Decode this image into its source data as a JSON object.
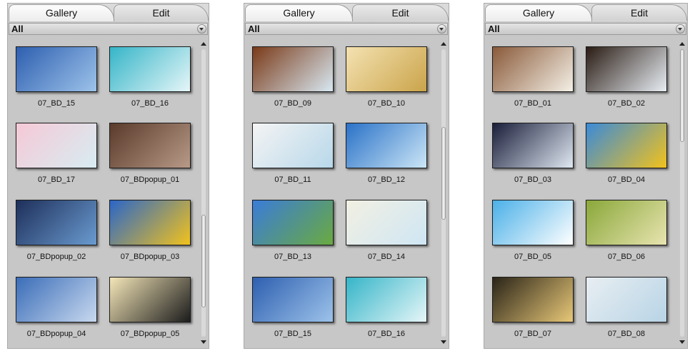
{
  "panels": [
    {
      "tabs": [
        "Gallery",
        "Edit"
      ],
      "filter": "All",
      "scroll_fraction": 0.85,
      "items": [
        {
          "label": "07_BD_15",
          "colors": [
            "#2e5fb0",
            "#9dc3ea"
          ]
        },
        {
          "label": "07_BD_16",
          "colors": [
            "#35b5c8",
            "#e6f6f8"
          ]
        },
        {
          "label": "07_BD_17",
          "colors": [
            "#f5c9d6",
            "#d8ecf2"
          ]
        },
        {
          "label": "07_BDpopup_01",
          "colors": [
            "#5a3a2a",
            "#b89a88"
          ]
        },
        {
          "label": "07_BDpopup_02",
          "colors": [
            "#1e2f5a",
            "#6a9bd0"
          ]
        },
        {
          "label": "07_BDpopup_03",
          "colors": [
            "#2a66c8",
            "#f2c21c"
          ]
        },
        {
          "label": "07_BDpopup_04",
          "colors": [
            "#3a6db8",
            "#c9d9ef"
          ]
        },
        {
          "label": "07_BDpopup_05",
          "colors": [
            "#f4e6b8",
            "#1c1c1c"
          ]
        }
      ]
    },
    {
      "tabs": [
        "Gallery",
        "Edit"
      ],
      "filter": "All",
      "scroll_fraction": 0.4,
      "items": [
        {
          "label": "07_BD_09",
          "colors": [
            "#7a3a18",
            "#d8e8f2"
          ]
        },
        {
          "label": "07_BD_10",
          "colors": [
            "#f4e2b2",
            "#caa44a"
          ]
        },
        {
          "label": "07_BD_11",
          "colors": [
            "#f4f4f4",
            "#b8d8ea"
          ]
        },
        {
          "label": "07_BD_12",
          "colors": [
            "#2a72c8",
            "#cce6f6"
          ]
        },
        {
          "label": "07_BD_13",
          "colors": [
            "#3a7cd8",
            "#6aaa40"
          ]
        },
        {
          "label": "07_BD_14",
          "colors": [
            "#f2f0e2",
            "#cfe6f4"
          ]
        },
        {
          "label": "07_BD_15",
          "colors": [
            "#2e5fb0",
            "#9dc3ea"
          ]
        },
        {
          "label": "07_BD_16",
          "colors": [
            "#35b5c8",
            "#e6f6f8"
          ]
        }
      ]
    },
    {
      "tabs": [
        "Gallery",
        "Edit"
      ],
      "filter": "All",
      "scroll_fraction": 0.0,
      "items": [
        {
          "label": "07_BD_01",
          "colors": [
            "#8a5a3a",
            "#f4f0e6"
          ]
        },
        {
          "label": "07_BD_02",
          "colors": [
            "#2a1c14",
            "#e8eef4"
          ]
        },
        {
          "label": "07_BD_03",
          "colors": [
            "#1a1e3a",
            "#dfe8f2"
          ]
        },
        {
          "label": "07_BD_04",
          "colors": [
            "#3a8ad8",
            "#f2c21c"
          ]
        },
        {
          "label": "07_BD_05",
          "colors": [
            "#4ab0e8",
            "#ffffff"
          ]
        },
        {
          "label": "07_BD_06",
          "colors": [
            "#8aa83a",
            "#e8e4b0"
          ]
        },
        {
          "label": "07_BD_07",
          "colors": [
            "#2a2418",
            "#e8c878"
          ]
        },
        {
          "label": "07_BD_08",
          "colors": [
            "#e8eef2",
            "#b8d4e6"
          ]
        }
      ]
    }
  ]
}
